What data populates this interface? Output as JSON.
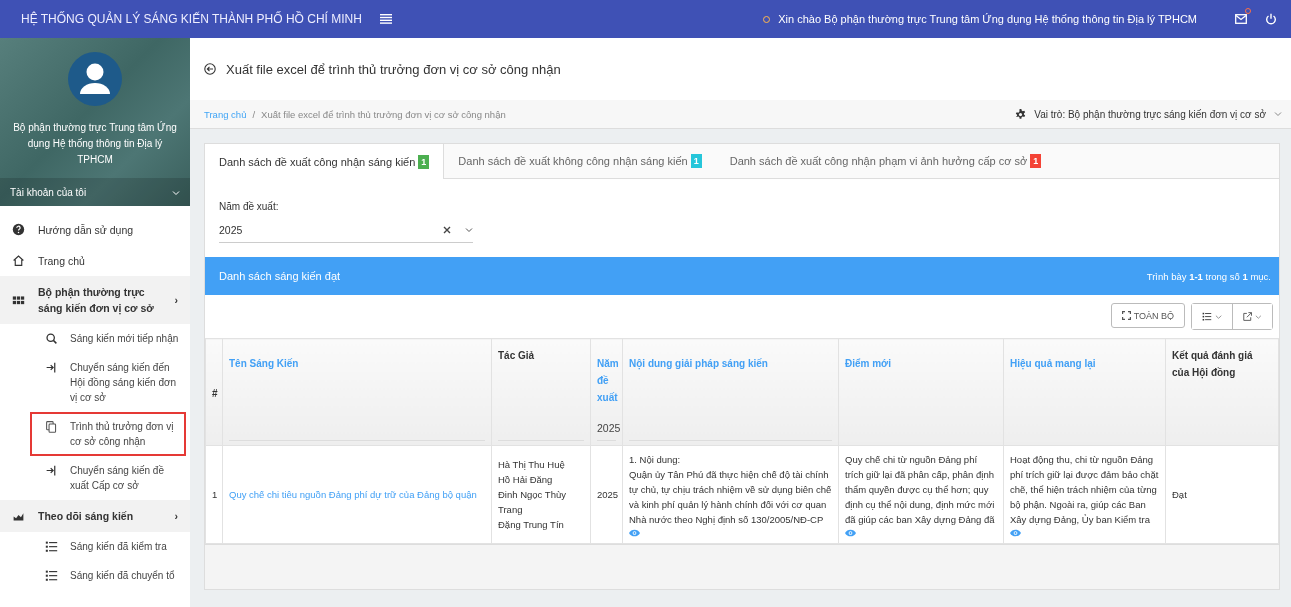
{
  "topbar": {
    "title": "HỆ THỐNG QUẢN LÝ SÁNG KIẾN THÀNH PHỐ HỒ CHÍ MINH",
    "greeting": "Xin chào Bộ phận thường trực Trung tâm Ứng dụng Hệ thống thông tin Địa lý TPHCM",
    "has_notification": true
  },
  "sidebar": {
    "user_name": "Bộ phận thường trực Trung tâm Ứng dụng Hệ thống thông tin Địa lý TPHCM",
    "account_label": "Tài khoản của tôi",
    "items": [
      {
        "kind": "item",
        "label": "Hướng dẫn sử dụng"
      },
      {
        "kind": "item",
        "label": "Trang chủ"
      },
      {
        "kind": "group",
        "label": "Bộ phận thường trực sáng kiến đơn vị cơ sở",
        "chevron": "›",
        "expanded": true,
        "children": [
          {
            "label": "Sáng kiến mới tiếp nhận",
            "selected": false
          },
          {
            "label": "Chuyển sáng kiến đến Hội đồng sáng kiến đơn vị cơ sở",
            "selected": false
          },
          {
            "label": "Trình thủ trưởng đơn vị cơ sở công nhận",
            "selected": true
          },
          {
            "label": "Chuyển sáng kiến đề xuất Cấp cơ sở",
            "selected": false
          }
        ]
      },
      {
        "kind": "group",
        "label": "Theo dõi sáng kiến",
        "chevron": "›",
        "expanded": true,
        "children": [
          {
            "label": "Sáng kiến đã kiểm tra",
            "selected": false
          },
          {
            "label": "Sáng kiến đã chuyển tổ",
            "selected": false
          }
        ]
      }
    ]
  },
  "page_title": "Xuất file excel để trình thủ trưởng đơn vị cơ sở công nhận",
  "breadcrumb": {
    "separator": "/",
    "items": [
      "Trang chủ",
      "Xuất file excel để trình thủ trưởng đơn vị cơ sở công nhận"
    ]
  },
  "role": "Vai trò: Bộ phận thường trực sáng kiến đơn vị cơ sở",
  "tabs": [
    {
      "label": "Danh sách đề xuất công nhận sáng kiến",
      "count": "1",
      "color": "#4caf50",
      "selected": true
    },
    {
      "label": "Danh sách đề xuất không công nhận sáng kiến",
      "count": "1",
      "color": "#26c6da",
      "selected": false
    },
    {
      "label": "Danh sách đề xuất công nhận phạm vi ảnh hưởng cấp cơ sở",
      "count": "1",
      "color": "#f44336",
      "selected": false
    }
  ],
  "year_filter": {
    "label": "Năm đề xuất:",
    "value": "2025"
  },
  "panel": {
    "title": "Danh sách sáng kiến đạt",
    "summary": "Trình bày **1-1** trong số **1** mục.",
    "full_button": "TOÀN BỘ"
  },
  "table": {
    "columns": [
      {
        "label": "#",
        "link": false,
        "filterable": false
      },
      {
        "label": "Tên Sáng Kiến",
        "link": true,
        "filterable": true
      },
      {
        "label": "Tác Giả",
        "link": false,
        "filterable": true
      },
      {
        "label": "Năm đề xuất",
        "link": true,
        "filterable": true,
        "filter": "2025"
      },
      {
        "label": "Nội dung giải pháp sáng kiến",
        "link": true,
        "filterable": true
      },
      {
        "label": "Điểm mới",
        "link": true,
        "filterable": false
      },
      {
        "label": "Hiệu quả mang lại",
        "link": true,
        "filterable": false
      },
      {
        "label": "Kết quả đánh giá của Hội đồng",
        "link": false,
        "filterable": false
      }
    ],
    "rows": [
      {
        "index": "1",
        "name": "Quy chế chi tiêu nguồn Đảng phí dự trữ của Đảng bộ quận",
        "authors": [
          "Hà Thị Thu Huệ",
          "Hồ Hải Đăng",
          "Đinh Ngọc Thùy Trang",
          "Đặng Trung Tín"
        ],
        "year": "2025",
        "content": "1. Nội dung:\nQuận ủy Tân Phú đã thực hiện chế độ tài chính tự chủ, tự chịu trách nhiệm về sử dụng biên chế và kinh phí quản lý hành chính đối với cơ quan Nhà nước theo Nghị định số 130/2005/NĐ-CP",
        "novelty": "Quy chế chi từ nguồn Đảng phí trích giữ lại đã phân cấp, phân định thẩm quyền được cụ thể hơn; quy định cụ thể nội dung, định mức mới đã giúp các ban Xây dựng Đảng đã",
        "effect": "Hoạt động thu, chi từ nguồn Đảng phí trích giữ lại được đảm bảo chặt chẽ, thể hiện trách nhiệm của từng bộ phận. Ngoài ra, giúp các Ban Xây dựng Đảng, Ủy ban Kiểm tra",
        "result": "Đạt"
      }
    ]
  }
}
